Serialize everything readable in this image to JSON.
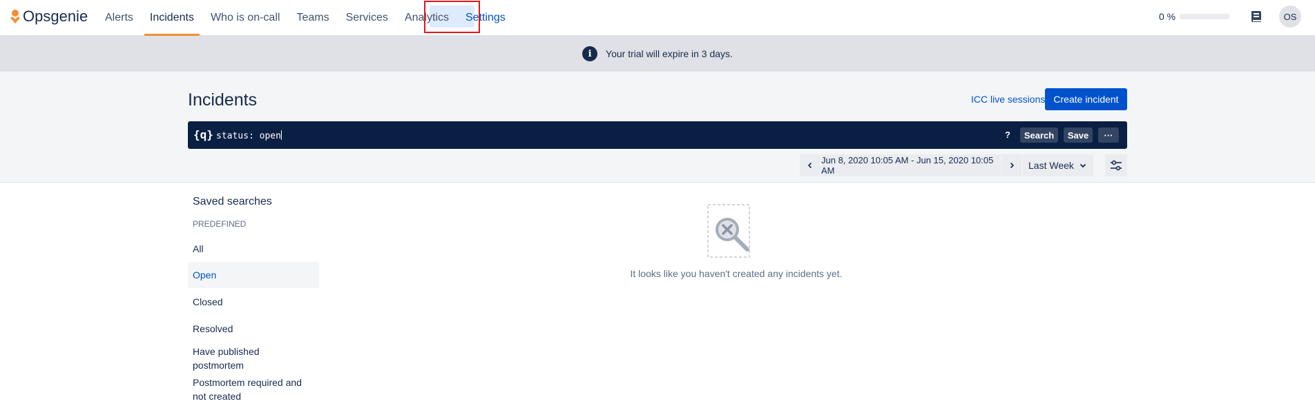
{
  "nav": {
    "logo_text": "Opsgenie",
    "items": [
      {
        "label": "Alerts"
      },
      {
        "label": "Incidents"
      },
      {
        "label": "Who is on-call"
      },
      {
        "label": "Teams"
      },
      {
        "label": "Services"
      },
      {
        "label": "Analytics"
      },
      {
        "label": "Settings"
      }
    ],
    "active_item": "Incidents",
    "progress_label": "0 %",
    "progress_value": 0,
    "avatar_initials": "OS"
  },
  "banner": {
    "text": "Your trial will expire in 3 days.",
    "icon": "info-icon"
  },
  "header": {
    "title": "Incidents",
    "icc_link": "ICC live sessions",
    "create_button": "Create incident"
  },
  "search": {
    "icon": "{q}",
    "query": "status: open",
    "help": "?",
    "search_button": "Search",
    "save_button": "Save",
    "more_button": "···"
  },
  "date_filter": {
    "range": "Jun 8, 2020 10:05 AM - Jun 15, 2020 10:05 AM",
    "preset": "Last Week"
  },
  "sidebar": {
    "title": "Saved searches",
    "section": "PREDEFINED",
    "items": [
      {
        "label": "All"
      },
      {
        "label": "Open"
      },
      {
        "label": "Closed"
      },
      {
        "label": "Resolved"
      },
      {
        "label": "Have published postmortem"
      },
      {
        "label": "Postmortem required and not created"
      }
    ],
    "selected": "Open"
  },
  "empty_state": {
    "text": "It looks like you haven't created any incidents yet."
  },
  "colors": {
    "brand_orange": "#f58e34",
    "primary_blue": "#0052cc",
    "navy": "#0a1f44",
    "highlight_red": "#e3161d"
  }
}
